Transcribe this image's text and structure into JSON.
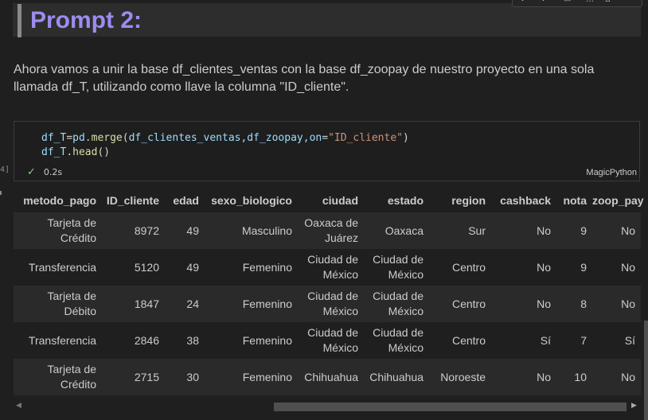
{
  "markdown": {
    "heading": "Prompt 2:",
    "paragraph": "Ahora vamos a unir la base df_clientes_ventas con la base df_zoopay de nuestro proyecto en una sola llamada df_T, utilizando como llave la columna \"ID_cliente\"."
  },
  "code_cell": {
    "execution_count": "4]",
    "line1": {
      "var": "df_T",
      "eq": "=",
      "mod": "pd",
      "dot": ".",
      "fn": "merge",
      "open": "(",
      "args": "df_clientes_ventas,df_zoopay,",
      "kw": "on",
      "eq2": "=",
      "str": "\"ID_cliente\"",
      "close": ")"
    },
    "line2": {
      "var": "df_T",
      "dot": ".",
      "fn": "head",
      "paren": "()"
    },
    "status_time": "0.2s",
    "language": "MagicPython"
  },
  "table": {
    "columns": [
      "metodo_pago",
      "ID_cliente",
      "edad",
      "sexo_biologico",
      "ciudad",
      "estado",
      "region",
      "cashback",
      "nota",
      "zoop_pay"
    ],
    "rows": [
      [
        "Tarjeta de Crédito",
        "8972",
        "49",
        "Masculino",
        "Oaxaca de Juárez",
        "Oaxaca",
        "Sur",
        "No",
        "9",
        "No"
      ],
      [
        "Transferencia",
        "5120",
        "49",
        "Femenino",
        "Ciudad de México",
        "Ciudad de México",
        "Centro",
        "No",
        "9",
        "No"
      ],
      [
        "Tarjeta de Débito",
        "1847",
        "24",
        "Femenino",
        "Ciudad de México",
        "Ciudad de México",
        "Centro",
        "No",
        "8",
        "No"
      ],
      [
        "Transferencia",
        "2846",
        "38",
        "Femenino",
        "Ciudad de México",
        "Ciudad de México",
        "Centro",
        "Sí",
        "7",
        "Sí"
      ],
      [
        "Tarjeta de Crédito",
        "2715",
        "30",
        "Femenino",
        "Chihuahua",
        "Chihuahua",
        "Noroeste",
        "No",
        "10",
        "No"
      ]
    ]
  },
  "icons": {
    "check": "check-icon",
    "scroll_left": "chevron-left-icon",
    "scroll_right": "chevron-right-icon"
  },
  "colors": {
    "heading": "#9d8cf0",
    "background": "#1f1f1f",
    "row_stripe": "#2a2a2a",
    "success": "#89d185"
  }
}
